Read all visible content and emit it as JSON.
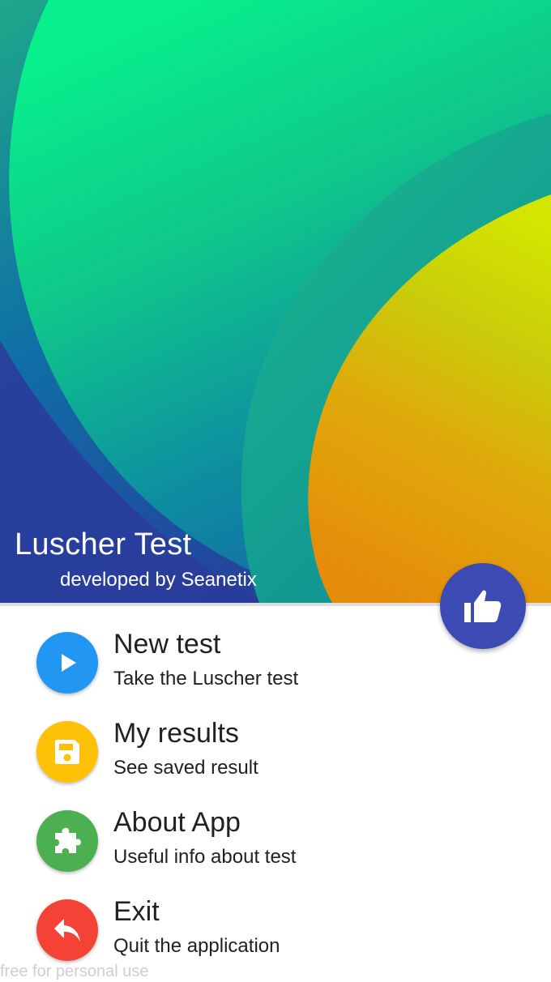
{
  "header": {
    "title": "Luscher Test",
    "subtitle": "developed by Seanetix"
  },
  "fab": {
    "icon": "thumbs-up-icon",
    "color": "#3c4bb3"
  },
  "menu": [
    {
      "title": "New test",
      "subtitle": "Take the Luscher test",
      "icon": "play-icon",
      "color": "#2196f3"
    },
    {
      "title": "My results",
      "subtitle": "See saved result",
      "icon": "save-icon",
      "color": "#ffc107"
    },
    {
      "title": "About App",
      "subtitle": "Useful info about test",
      "icon": "puzzle-icon",
      "color": "#4caf50"
    },
    {
      "title": "Exit",
      "subtitle": "Quit the application",
      "icon": "reply-icon",
      "color": "#f44336"
    }
  ],
  "watermark": "free for personal use"
}
